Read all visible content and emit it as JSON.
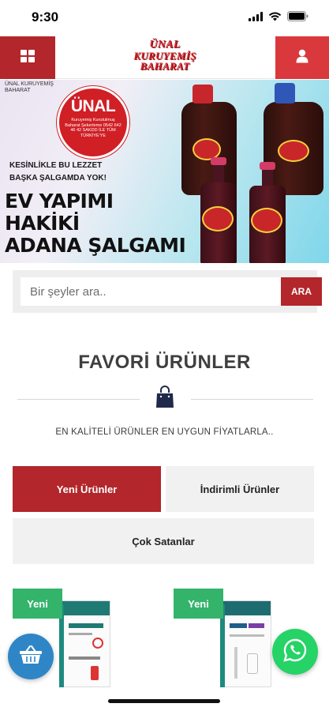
{
  "status_bar": {
    "time": "9:30"
  },
  "header": {
    "logo_lines": [
      "ÜNAL",
      "KURUYEMİŞ",
      "BAHARAT"
    ]
  },
  "banner": {
    "small_brand": "ÜNAL KURUYEMİŞ BAHARAT",
    "logo_name": "ÜNAL",
    "logo_sub": "Kuruyemiş Kurutulmuş Baharat Şekerleme 0542 642 46 42 SAKDD İLE TÜM TÜRKİYE'YE",
    "tagline_1": "KESİNLİKLE BU LEZZET",
    "tagline_2": "BAŞKA ŞALGAMDA YOK!",
    "headline_1": "EV YAPIMI",
    "headline_2": "HAKİKİ",
    "headline_3": "ADANA ŞALGAMI"
  },
  "search": {
    "placeholder": "Bir şeyler ara..",
    "button_label": "ARA"
  },
  "section": {
    "title": "FAVORİ ÜRÜNLER",
    "subtitle": "EN KALİTELİ ÜRÜNLER EN UYGUN FİYATLARLA.."
  },
  "tabs": {
    "new_label": "Yeni Ürünler",
    "discount_label": "İndirimli Ürünler",
    "best_label": "Çok Satanlar"
  },
  "products": [
    {
      "badge": "Yeni"
    },
    {
      "badge": "Yeni"
    }
  ],
  "colors": {
    "brand_red": "#b3262b",
    "user_red": "#d9393c",
    "badge_green": "#33b46a",
    "cart_blue": "#2f86c6",
    "whatsapp_green": "#25d366"
  },
  "icons": {
    "menu": "grid-icon",
    "user": "user-icon",
    "section": "shopping-bag-icon",
    "cart": "basket-icon",
    "chat": "whatsapp-icon"
  }
}
